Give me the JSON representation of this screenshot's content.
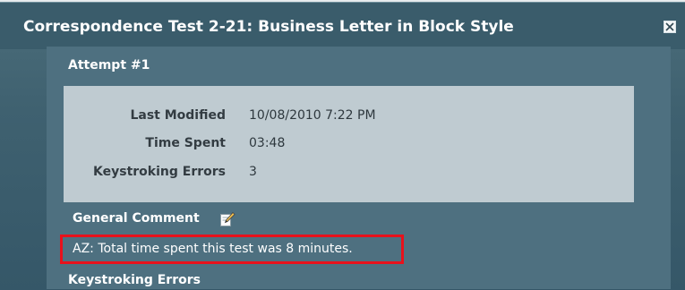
{
  "background": {
    "partial_text": ""
  },
  "dialog": {
    "title": "Correspondence Test 2-21: Business Letter in Block Style",
    "close_icon": "close-x-box-icon"
  },
  "attempt": {
    "label": "Attempt #1"
  },
  "details": [
    {
      "label": "Last Modified",
      "value": "10/08/2010 7:22 PM"
    },
    {
      "label": "Time Spent",
      "value": "03:48"
    },
    {
      "label": "Keystroking Errors",
      "value": "3"
    }
  ],
  "general_comment": {
    "label": "General Comment",
    "edit_icon": "pencil-edit-icon",
    "text": "AZ: Total time spent this test was 8 minutes."
  },
  "keystroking_errors_section": {
    "label": "Keystroking Errors"
  },
  "colors": {
    "title_bar": "#3a5c6b",
    "panel": "#4e7080",
    "info_box": "#bfcbd1",
    "highlight": "#e8111b"
  }
}
